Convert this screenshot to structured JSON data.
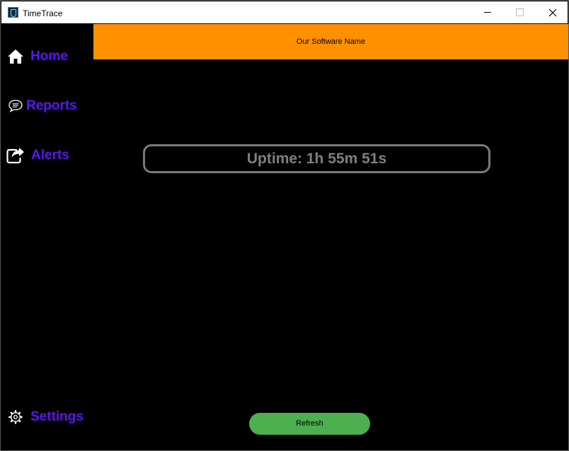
{
  "window": {
    "title": "TimeTrace"
  },
  "header": {
    "banner_text": "Our Software Name"
  },
  "sidebar": {
    "items": [
      {
        "label": "Home",
        "icon": "home-icon"
      },
      {
        "label": "Reports",
        "icon": "chat-bubble-icon"
      },
      {
        "label": "Alerts",
        "icon": "share-icon"
      },
      {
        "label": "Settings",
        "icon": "gear-icon"
      }
    ]
  },
  "main": {
    "uptime_text": "Uptime: 1h 55m 51s",
    "refresh_label": "Refresh"
  },
  "colors": {
    "banner": "#ff9000",
    "sidebar_text": "#5b15f5",
    "refresh_button": "#4caf50",
    "uptime_border": "#7a7a7a"
  }
}
